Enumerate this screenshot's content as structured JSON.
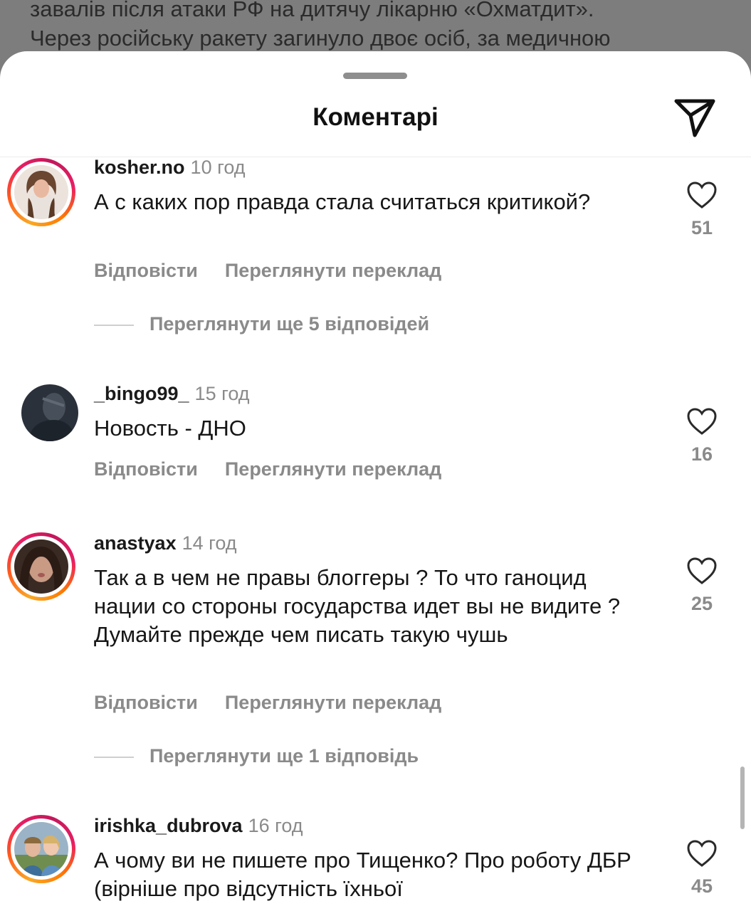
{
  "background_post": {
    "line1": "завалів після атаки РФ на дитячу лікарню «Охматдит».",
    "line2": "Через російську ракету загинуло двоє осіб, за медичною"
  },
  "sheet": {
    "title": "Коментарі",
    "send_icon": "paper-plane-icon"
  },
  "comments": [
    {
      "username": "kosher.no",
      "time": "10 год",
      "text": "А с каких пор правда стала считаться критикой?",
      "reply_label": "Відповісти",
      "translate_label": "Переглянути переклад",
      "likes": "51",
      "more_replies": "Переглянути ще 5 відповідей",
      "has_story_ring": true
    },
    {
      "username": "_bingo99_",
      "time": "15 год",
      "text": "Новость - ДНО",
      "reply_label": "Відповісти",
      "translate_label": "Переглянути переклад",
      "likes": "16",
      "has_story_ring": false
    },
    {
      "username": "anastyax",
      "time": "14 год",
      "text": "Так а в чем не правы блоггеры ? То что ганоцид нации со стороны государства идет вы не видите ? Думайте прежде чем писать такую чушь",
      "reply_label": "Відповісти",
      "translate_label": "Переглянути переклад",
      "likes": "25",
      "more_replies": "Переглянути ще 1 відповідь",
      "has_story_ring": true
    },
    {
      "username": "irishka_dubrova",
      "time": "16 год",
      "text": "А чому ви не пишете про Тищенко? Про роботу ДБР (вірніше про відсутність їхньої",
      "likes": "45",
      "has_story_ring": true
    }
  ],
  "colors": {
    "muted": "#8a8a8a",
    "story_ring_start": "#f9a825",
    "story_ring_end": "#c2185b",
    "sheet": "#ffffff",
    "backdrop": "#7d7d7d"
  }
}
